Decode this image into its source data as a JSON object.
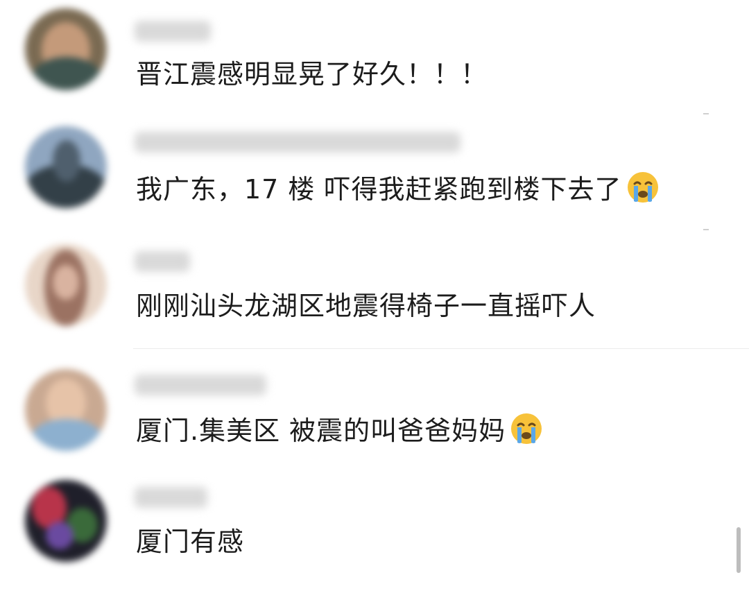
{
  "comments": [
    {
      "text": "晋江震感明显晃了好久！！！",
      "emoji": ""
    },
    {
      "text": "我广东，17 楼 吓得我赶紧跑到楼下去了",
      "emoji": "loudly-crying-face-icon"
    },
    {
      "text": "刚刚汕头龙湖区地震得椅子一直摇吓人",
      "emoji": ""
    },
    {
      "text": "厦门.集美区  被震的叫爸爸妈妈",
      "emoji": "loudly-crying-face-icon"
    },
    {
      "text": "厦门有感",
      "emoji": ""
    }
  ],
  "colors": {
    "text": "#1c1c1c",
    "username_blur": "#d9d9d9",
    "divider": "#ececec",
    "scrollbar": "#bdbdbd",
    "emoji_face": "#f7c23a",
    "emoji_tears": "#5aa7e8"
  }
}
